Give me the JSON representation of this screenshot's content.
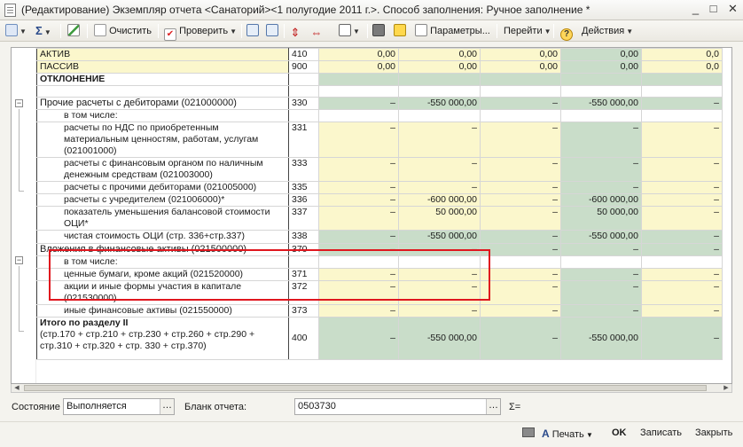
{
  "window": {
    "title": "(Редактирование) Экземпляр отчета <Санаторий><1 полугодие 2011 г.>. Способ заполнения: Ручное заполнение *",
    "minimize": "_",
    "maximize": "□",
    "close": "✕"
  },
  "toolbar": {
    "clear_label": "Очистить",
    "check_label": "Проверить",
    "params_label": "Параметры...",
    "goto_label": "Перейти",
    "actions_label": "Действия",
    "sigma": "Σ",
    "help": "?"
  },
  "rows": [
    {
      "name": "АКТИВ",
      "code": "410",
      "c1": "0,00",
      "c2": "0,00",
      "c3": "0,00",
      "c4": "0,00",
      "c5": "0,0"
    },
    {
      "name": "ПАССИВ",
      "code": "900",
      "c1": "0,00",
      "c2": "0,00",
      "c3": "0,00",
      "c4": "0,00",
      "c5": "0,0"
    },
    {
      "name": "ОТКЛОНЕНИЕ"
    },
    {
      "name": "Прочие расчеты с дебиторами (021000000)",
      "code": "330",
      "c1": "–",
      "c2": "-550 000,00",
      "c3": "–",
      "c4": "-550 000,00",
      "c5": "–"
    },
    {
      "name": "в том числе:"
    },
    {
      "name": "расчеты по НДС по приобретенным материальным ценностям, работам, услугам (021001000)",
      "code": "331",
      "c1": "–",
      "c2": "–",
      "c3": "–",
      "c4": "–",
      "c5": "–"
    },
    {
      "name": "расчеты с финансовым органом по наличным денежным средствам (021003000)",
      "code": "333",
      "c1": "–",
      "c2": "–",
      "c3": "–",
      "c4": "–",
      "c5": "–"
    },
    {
      "name": "расчеты с прочими дебиторами (021005000)",
      "code": "335",
      "c1": "–",
      "c2": "–",
      "c3": "–",
      "c4": "–",
      "c5": "–"
    },
    {
      "name": "расчеты с учредителем (021006000)*",
      "code": "336",
      "c1": "–",
      "c2": "-600 000,00",
      "c3": "–",
      "c4": "-600 000,00",
      "c5": "–"
    },
    {
      "name": "показатель уменьшения балансовой стоимости ОЦИ*",
      "code": "337",
      "c1": "–",
      "c2": "50 000,00",
      "c3": "–",
      "c4": "50 000,00",
      "c5": "–"
    },
    {
      "name": "чистая стоимость ОЦИ (стр. 336+стр.337)",
      "code": "338",
      "c1": "–",
      "c2": "-550 000,00",
      "c3": "–",
      "c4": "-550 000,00",
      "c5": "–"
    },
    {
      "name": "Вложения в финансовые активы (021500000)",
      "code": "370",
      "c1": "–",
      "c2": "–",
      "c3": "–",
      "c4": "–",
      "c5": "–"
    },
    {
      "name": "в том числе:"
    },
    {
      "name": "ценные бумаги, кроме акций  (021520000)",
      "code": "371",
      "c1": "–",
      "c2": "–",
      "c3": "–",
      "c4": "–",
      "c5": "–"
    },
    {
      "name": "акции и иные формы участия в капитале (021530000)",
      "code": "372",
      "c1": "–",
      "c2": "–",
      "c3": "–",
      "c4": "–",
      "c5": "–"
    },
    {
      "name": "иные финансовые активы (021550000)",
      "code": "373",
      "c1": "–",
      "c2": "–",
      "c3": "–",
      "c4": "–",
      "c5": "–"
    },
    {
      "name": "Итого по разделу II",
      "name2": " (стр.170  + стр.210 + стр.230 + стр.260 + стр.290 + стр.310 + стр.320 + стр. 330 + стр.370)",
      "code": "400",
      "c1": "–",
      "c2": "-550 000,00",
      "c3": "–",
      "c4": "-550 000,00",
      "c5": "–"
    }
  ],
  "status": {
    "state_label": "Состояние",
    "state_value": "Выполняется",
    "form_label": "Бланк отчета:",
    "form_value": "0503730",
    "sum_label": "Σ="
  },
  "footer": {
    "print_label": "Печать",
    "ok_label": "OK",
    "save_label": "Записать",
    "close_label": "Закрыть"
  }
}
